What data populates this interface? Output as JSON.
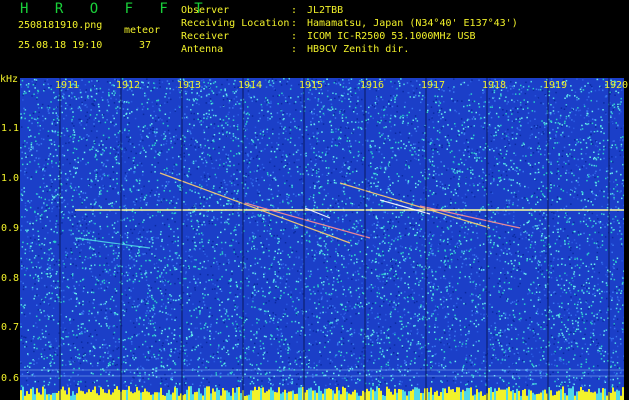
{
  "header": {
    "logo": "H R O F F T",
    "filename": "2508181910.png",
    "meteor_label": "meteor",
    "datetime": "25.08.18 19:10",
    "meteor_count": "37"
  },
  "info": [
    {
      "key": "Observer",
      "value": "JL2TBB"
    },
    {
      "key": "Receiving Location",
      "value": "Hamamatsu, Japan (N34°40' E137°43')"
    },
    {
      "key": "Receiver",
      "value": "ICOM IC-R2500 53.1000MHz USB"
    },
    {
      "key": "Antenna",
      "value": "HB9CV Zenith dir."
    }
  ],
  "spectrogram": {
    "unit": "kHz",
    "time_ticks": [
      "1911",
      "1912",
      "1913",
      "1914",
      "1915",
      "1916",
      "1917",
      "1918",
      "1919",
      "1920"
    ],
    "freq_ticks": [
      "1.1",
      "1.0",
      "0.9",
      "0.8",
      "0.7",
      "0.6"
    ],
    "colors": {
      "background": "#1b3fc8",
      "noise_high": "#4fd8e8",
      "carrier": "#ffff9a",
      "baseline": "#f2f22a"
    }
  }
}
